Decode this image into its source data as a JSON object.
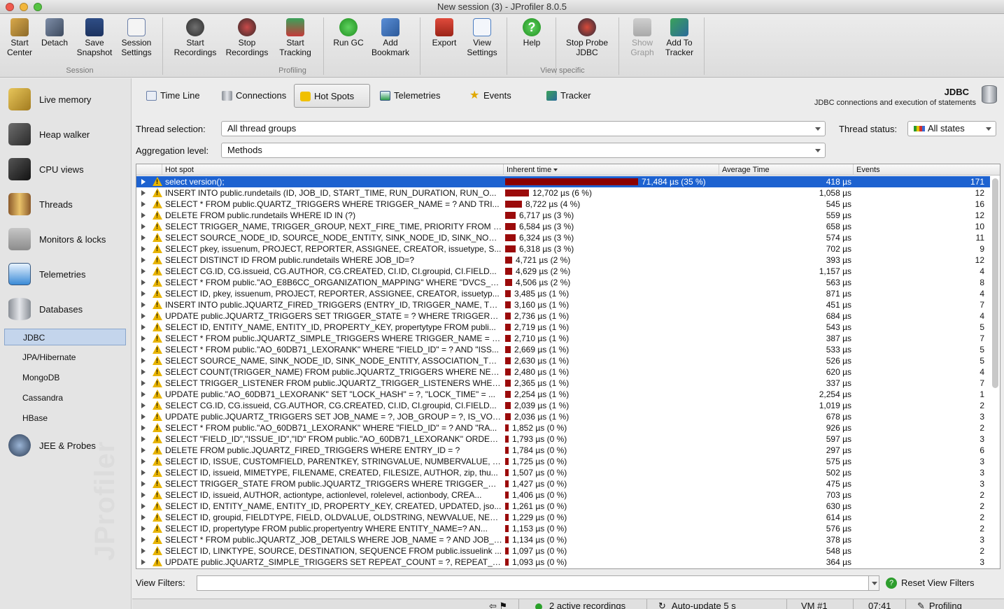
{
  "window": {
    "title": "New session (3) - JProfiler 8.0.5"
  },
  "toolbar": {
    "start_center": "Start Center",
    "detach": "Detach",
    "save_snapshot": "Save Snapshot",
    "session_settings": "Session Settings",
    "start_recordings": "Start Recordings",
    "stop_recordings": "Stop Recordings",
    "start_tracking": "Start Tracking",
    "run_gc": "Run GC",
    "add_bookmark": "Add Bookmark",
    "export": "Export",
    "view_settings": "View Settings",
    "help": "Help",
    "stop_probe_jdbc": "Stop Probe JDBC",
    "show_graph": "Show Graph",
    "add_to_tracker": "Add To Tracker",
    "group_session": "Session",
    "group_profiling": "Profiling",
    "group_view_specific": "View specific"
  },
  "sidebar": {
    "live_memory": "Live memory",
    "heap_walker": "Heap walker",
    "cpu_views": "CPU views",
    "threads": "Threads",
    "monitors_locks": "Monitors & locks",
    "telemetries": "Telemetries",
    "databases": "Databases",
    "jdbc": "JDBC",
    "jpa": "JPA/Hibernate",
    "mongodb": "MongoDB",
    "cassandra": "Cassandra",
    "hbase": "HBase",
    "jee_probes": "JEE & Probes",
    "watermark": "JProfiler"
  },
  "tabs": {
    "timeline": "Time Line",
    "connections": "Connections",
    "hotspots": "Hot Spots",
    "telemetries": "Telemetries",
    "events": "Events",
    "tracker": "Tracker"
  },
  "view": {
    "title": "JDBC",
    "description": "JDBC connections and execution of statements"
  },
  "filters": {
    "thread_selection_label": "Thread selection:",
    "thread_selection_value": "All thread groups",
    "thread_status_label": "Thread status:",
    "thread_status_value": "All states",
    "aggregation_label": "Aggregation level:",
    "aggregation_value": "Methods",
    "view_filters_label": "View Filters:",
    "view_filters_value": "",
    "reset_label": "Reset View Filters"
  },
  "table": {
    "headers": {
      "hotspot": "Hot spot",
      "inherent": "Inherent time",
      "average": "Average Time",
      "events": "Events"
    },
    "rows": [
      {
        "name": "select version();",
        "inherent": "71,484 µs (35 %)",
        "avg": "418 µs",
        "events": "171",
        "pct": 35,
        "selected": true
      },
      {
        "name": "INSERT INTO public.rundetails (ID, JOB_ID, START_TIME, RUN_DURATION, RUN_O...",
        "inherent": "12,702 µs (6 %)",
        "avg": "1,058 µs",
        "events": "12",
        "pct": 6
      },
      {
        "name": "SELECT * FROM public.QUARTZ_TRIGGERS WHERE TRIGGER_NAME = ? AND TRI...",
        "inherent": "8,722 µs (4 %)",
        "avg": "545 µs",
        "events": "16",
        "pct": 4
      },
      {
        "name": "DELETE FROM public.rundetails WHERE ID IN (?)",
        "inherent": "6,717 µs (3 %)",
        "avg": "559 µs",
        "events": "12",
        "pct": 3
      },
      {
        "name": "SELECT TRIGGER_NAME, TRIGGER_GROUP, NEXT_FIRE_TIME, PRIORITY FROM pu...",
        "inherent": "6,584 µs (3 %)",
        "avg": "658 µs",
        "events": "10",
        "pct": 3
      },
      {
        "name": "SELECT SOURCE_NODE_ID, SOURCE_NODE_ENTITY, SINK_NODE_ID, SINK_NODE_...",
        "inherent": "6,324 µs (3 %)",
        "avg": "574 µs",
        "events": "11",
        "pct": 3
      },
      {
        "name": "SELECT pkey, issuenum, PROJECT, REPORTER, ASSIGNEE, CREATOR, issuetype, S...",
        "inherent": "6,318 µs (3 %)",
        "avg": "702 µs",
        "events": "9",
        "pct": 3
      },
      {
        "name": "SELECT DISTINCT ID FROM public.rundetails WHERE JOB_ID=?",
        "inherent": "4,721 µs (2 %)",
        "avg": "393 µs",
        "events": "12",
        "pct": 2
      },
      {
        "name": "SELECT CG.ID, CG.issueid, CG.AUTHOR, CG.CREATED, CI.ID, CI.groupid, CI.FIELD...",
        "inherent": "4,629 µs (2 %)",
        "avg": "1,157 µs",
        "events": "4",
        "pct": 2
      },
      {
        "name": "SELECT * FROM public.\"AO_E8B6CC_ORGANIZATION_MAPPING\" WHERE \"DVCS_TY...",
        "inherent": "4,506 µs (2 %)",
        "avg": "563 µs",
        "events": "8",
        "pct": 2
      },
      {
        "name": "SELECT ID, pkey, issuenum, PROJECT, REPORTER, ASSIGNEE, CREATOR, issuetyp...",
        "inherent": "3,485 µs (1 %)",
        "avg": "871 µs",
        "events": "4",
        "pct": 1
      },
      {
        "name": "INSERT INTO public.JQUARTZ_FIRED_TRIGGERS (ENTRY_ID, TRIGGER_NAME, TRI...",
        "inherent": "3,160 µs (1 %)",
        "avg": "451 µs",
        "events": "7",
        "pct": 1
      },
      {
        "name": "UPDATE public.JQUARTZ_TRIGGERS SET TRIGGER_STATE = ? WHERE TRIGGER_N...",
        "inherent": "2,736 µs (1 %)",
        "avg": "684 µs",
        "events": "4",
        "pct": 1
      },
      {
        "name": "SELECT ID, ENTITY_NAME, ENTITY_ID, PROPERTY_KEY, propertytype FROM publi...",
        "inherent": "2,719 µs (1 %)",
        "avg": "543 µs",
        "events": "5",
        "pct": 1
      },
      {
        "name": "SELECT * FROM public.JQUARTZ_SIMPLE_TRIGGERS WHERE TRIGGER_NAME = ? A...",
        "inherent": "2,710 µs (1 %)",
        "avg": "387 µs",
        "events": "7",
        "pct": 1
      },
      {
        "name": "SELECT * FROM public.\"AO_60DB71_LEXORANK\" WHERE \"FIELD_ID\" = ? AND \"ISS...",
        "inherent": "2,669 µs (1 %)",
        "avg": "533 µs",
        "events": "5",
        "pct": 1
      },
      {
        "name": "SELECT SOURCE_NAME, SINK_NODE_ID, SINK_NODE_ENTITY, ASSOCIATION_TYPE...",
        "inherent": "2,630 µs (1 %)",
        "avg": "526 µs",
        "events": "5",
        "pct": 1
      },
      {
        "name": "SELECT COUNT(TRIGGER_NAME) FROM public.JQUARTZ_TRIGGERS WHERE NEXT...",
        "inherent": "2,480 µs (1 %)",
        "avg": "620 µs",
        "events": "4",
        "pct": 1
      },
      {
        "name": "SELECT TRIGGER_LISTENER FROM public.JQUARTZ_TRIGGER_LISTENERS WHERE ...",
        "inherent": "2,365 µs (1 %)",
        "avg": "337 µs",
        "events": "7",
        "pct": 1
      },
      {
        "name": "UPDATE public.\"AO_60DB71_LEXORANK\" SET \"LOCK_HASH\" = ?, \"LOCK_TIME\" = ...",
        "inherent": "2,254 µs (1 %)",
        "avg": "2,254 µs",
        "events": "1",
        "pct": 1
      },
      {
        "name": "SELECT CG.ID, CG.issueid, CG.AUTHOR, CG.CREATED, CI.ID, CI.groupid, CI.FIELD...",
        "inherent": "2,039 µs (1 %)",
        "avg": "1,019 µs",
        "events": "2",
        "pct": 1
      },
      {
        "name": "UPDATE public.JQUARTZ_TRIGGERS SET JOB_NAME = ?, JOB_GROUP = ?, IS_VOL...",
        "inherent": "2,036 µs (1 %)",
        "avg": "678 µs",
        "events": "3",
        "pct": 1
      },
      {
        "name": "SELECT * FROM public.\"AO_60DB71_LEXORANK\" WHERE \"FIELD_ID\" = ? AND \"RA...",
        "inherent": "1,852 µs (0 %)",
        "avg": "926 µs",
        "events": "2",
        "pct": 0
      },
      {
        "name": "SELECT \"FIELD_ID\",\"ISSUE_ID\",\"ID\" FROM public.\"AO_60DB71_LEXORANK\" ORDER ...",
        "inherent": "1,793 µs (0 %)",
        "avg": "597 µs",
        "events": "3",
        "pct": 0
      },
      {
        "name": "DELETE FROM public.JQUARTZ_FIRED_TRIGGERS WHERE ENTRY_ID = ?",
        "inherent": "1,784 µs (0 %)",
        "avg": "297 µs",
        "events": "6",
        "pct": 0
      },
      {
        "name": "SELECT ID, ISSUE, CUSTOMFIELD, PARENTKEY, STRINGVALUE, NUMBERVALUE, TE...",
        "inherent": "1,725 µs (0 %)",
        "avg": "575 µs",
        "events": "3",
        "pct": 0
      },
      {
        "name": "SELECT ID, issueid, MIMETYPE, FILENAME, CREATED, FILESIZE, AUTHOR, zip, thu...",
        "inherent": "1,507 µs (0 %)",
        "avg": "502 µs",
        "events": "3",
        "pct": 0
      },
      {
        "name": "SELECT TRIGGER_STATE FROM public.JQUARTZ_TRIGGERS WHERE TRIGGER_NA...",
        "inherent": "1,427 µs (0 %)",
        "avg": "475 µs",
        "events": "3",
        "pct": 0
      },
      {
        "name": "SELECT ID, issueid, AUTHOR, actiontype, actionlevel, rolelevel, actionbody, CREA...",
        "inherent": "1,406 µs (0 %)",
        "avg": "703 µs",
        "events": "2",
        "pct": 0
      },
      {
        "name": "SELECT ID, ENTITY_NAME, ENTITY_ID, PROPERTY_KEY, CREATED, UPDATED, jso...",
        "inherent": "1,261 µs (0 %)",
        "avg": "630 µs",
        "events": "2",
        "pct": 0
      },
      {
        "name": "SELECT ID, groupid, FIELDTYPE, FIELD, OLDVALUE, OLDSTRING, NEWVALUE, NEW...",
        "inherent": "1,229 µs (0 %)",
        "avg": "614 µs",
        "events": "2",
        "pct": 0
      },
      {
        "name": "SELECT ID, propertytype FROM public.propertyentry WHERE ENTITY_NAME=? AN...",
        "inherent": "1,153 µs (0 %)",
        "avg": "576 µs",
        "events": "2",
        "pct": 0
      },
      {
        "name": "SELECT * FROM public.JQUARTZ_JOB_DETAILS WHERE JOB_NAME = ? AND JOB_G...",
        "inherent": "1,134 µs (0 %)",
        "avg": "378 µs",
        "events": "3",
        "pct": 0
      },
      {
        "name": "SELECT ID, LINKTYPE, SOURCE, DESTINATION, SEQUENCE FROM public.issuelink ...",
        "inherent": "1,097 µs (0 %)",
        "avg": "548 µs",
        "events": "2",
        "pct": 0
      },
      {
        "name": "UPDATE public.JQUARTZ_SIMPLE_TRIGGERS SET REPEAT_COUNT = ?, REPEAT_IN...",
        "inherent": "1,093 µs (0 %)",
        "avg": "364 µs",
        "events": "3",
        "pct": 0
      }
    ]
  },
  "status": {
    "active_recordings": "2 active recordings",
    "auto_update": "Auto-update 5 s",
    "vm": "VM #1",
    "time": "07:41",
    "mode": "Profiling"
  }
}
